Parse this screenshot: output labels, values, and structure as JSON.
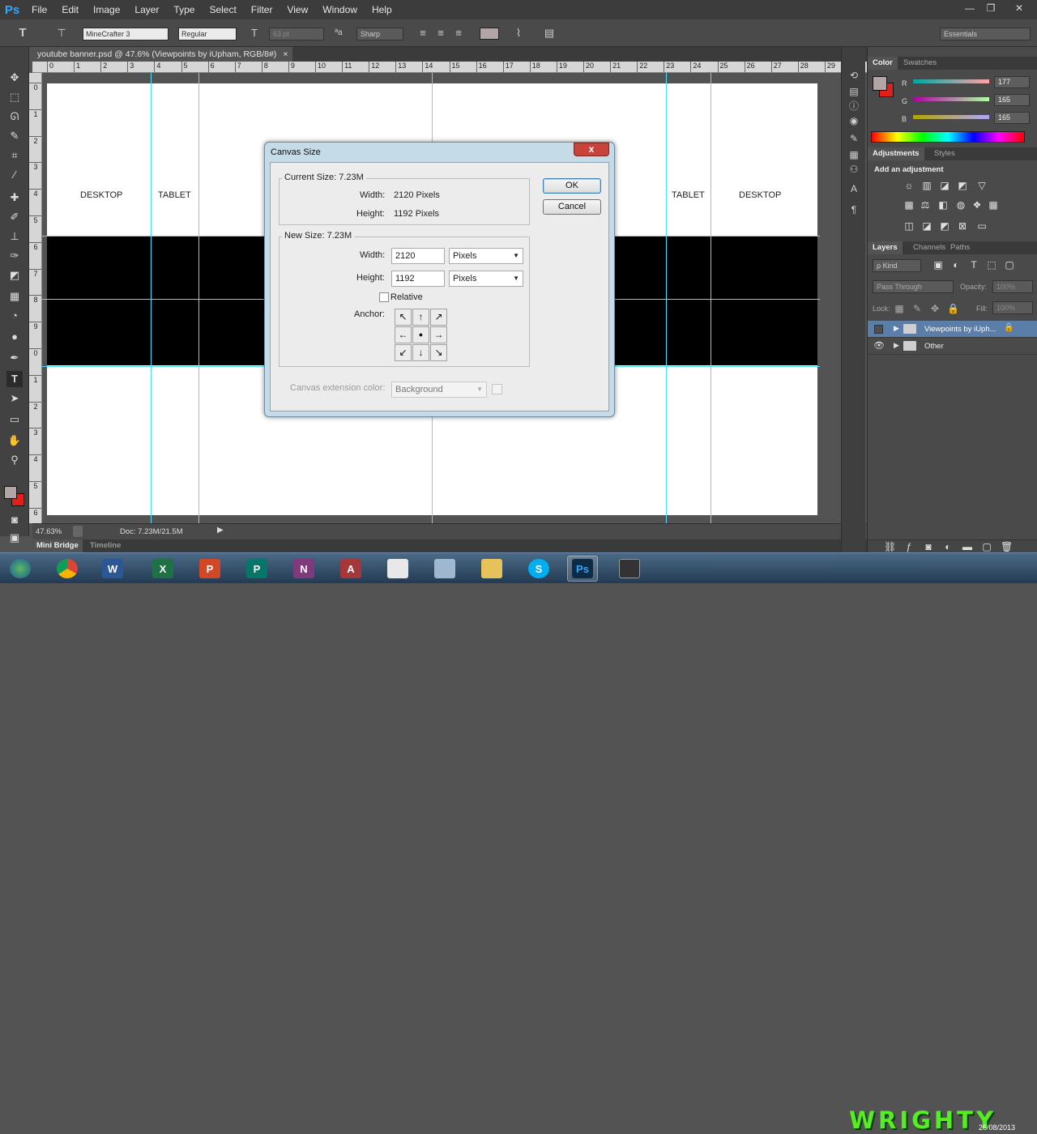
{
  "app": {
    "logo": "Ps",
    "menu": [
      "File",
      "Edit",
      "Image",
      "Layer",
      "Type",
      "Select",
      "Filter",
      "View",
      "Window",
      "Help"
    ],
    "window_controls": {
      "minimize": "—",
      "restore": "❐",
      "close": "✕"
    }
  },
  "options_bar": {
    "tool_icon": "T",
    "font_family": "MineCrafter 3",
    "font_style": "Regular",
    "font_size": "63 pt",
    "aa_glyph": "ªa",
    "antialias": "Sharp",
    "workspace": "Essentials"
  },
  "document": {
    "tab_title": "youtube banner.psd @ 47.6% (Viewpoints by iUpham, RGB/8#)",
    "tab_close": "×",
    "zoom": "47.63%",
    "doc_size": "Doc: 7.23M/21.5M",
    "hruler_ticks": [
      "0",
      "1",
      "2",
      "3",
      "4",
      "5",
      "6",
      "7",
      "8",
      "9",
      "10",
      "11",
      "12",
      "13",
      "14",
      "15",
      "16",
      "17",
      "18",
      "19",
      "20",
      "21",
      "22",
      "23",
      "24",
      "25",
      "26",
      "27",
      "28",
      "29"
    ],
    "vruler_ticks": [
      "0",
      "1",
      "2",
      "3",
      "4",
      "5",
      "6",
      "7",
      "8",
      "9",
      "0",
      "1",
      "2",
      "3",
      "4",
      "5",
      "6"
    ],
    "labels": {
      "desktop_left": "DESKTOP",
      "tablet_left": "TABLET",
      "tablet_right": "TABLET",
      "desktop_right": "DESKTOP"
    }
  },
  "bottom_tabs": {
    "mini_bridge": "Mini Bridge",
    "timeline": "Timeline"
  },
  "color_panel": {
    "tabs": [
      "Color",
      "Swatches"
    ],
    "r_label": "R",
    "g_label": "G",
    "b_label": "B",
    "r": "177",
    "g": "165",
    "b": "165",
    "foreground": "#b1a5a5",
    "background": "#e0201b"
  },
  "adjustments_panel": {
    "tabs": [
      "Adjustments",
      "Styles"
    ],
    "heading": "Add an adjustment"
  },
  "layers_panel": {
    "tabs": [
      "Layers",
      "Channels",
      "Paths"
    ],
    "filter": "ρ Kind",
    "blend_mode": "Pass Through",
    "opacity_label": "Opacity:",
    "opacity": "100%",
    "lock_label": "Lock:",
    "fill_label": "Fill:",
    "fill": "100%",
    "layers": [
      {
        "name": "Viewpoints by iUph...",
        "visible": false,
        "locked": true
      },
      {
        "name": "Other",
        "visible": true,
        "locked": false
      }
    ]
  },
  "dialog": {
    "title": "Canvas Size",
    "close": "x",
    "current_size": "Current Size: 7.23M",
    "width_label": "Width:",
    "height_label": "Height:",
    "current_width": "2120 Pixels",
    "current_height": "1192 Pixels",
    "new_size": "New Size: 7.23M",
    "new_width": "2120",
    "new_height": "1192",
    "width_unit": "Pixels",
    "height_unit": "Pixels",
    "relative_label": "Relative",
    "relative_checked": false,
    "anchor_label": "Anchor:",
    "anchor_arrows": [
      "↖",
      "↑",
      "↗",
      "←",
      "●",
      "→",
      "↙",
      "↓",
      "↘"
    ],
    "extension_label": "Canvas extension color:",
    "extension_value": "Background",
    "ok": "OK",
    "cancel": "Cancel"
  },
  "taskbar": {
    "apps": [
      "W",
      "X",
      "P",
      "P",
      "N",
      "A",
      "",
      "",
      "",
      "S",
      "Ps",
      ""
    ],
    "watermark": "WRIGHTY",
    "date": "26/08/2013"
  }
}
